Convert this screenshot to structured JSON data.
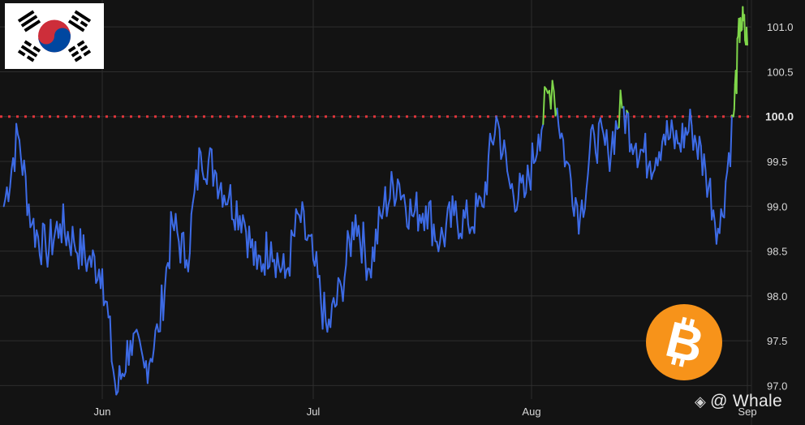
{
  "chart_data": {
    "type": "line",
    "title": "",
    "xlabel": "",
    "ylabel": "",
    "x_ticks": [
      "Jun",
      "Jul",
      "Aug",
      "Sep"
    ],
    "y_ticks": [
      "97.0",
      "97.5",
      "98.0",
      "98.5",
      "99.0",
      "99.5",
      "100.0",
      "100.5",
      "101.0"
    ],
    "ylim": [
      96.85,
      101.3
    ],
    "grid": true,
    "reference_line": {
      "value": 100.0,
      "label": "100.0",
      "color": "#e0353b",
      "style": "dotted"
    },
    "colors": {
      "below": "#3d6be6",
      "above": "#7fd64a",
      "background": "#131313",
      "grid": "#2e2e2e"
    },
    "series": [
      {
        "x": [
          "May 18",
          "May 20",
          "May 22",
          "May 24",
          "May 26",
          "May 28",
          "May 30",
          "Jun 01",
          "Jun 03",
          "Jun 05",
          "Jun 07",
          "Jun 09",
          "Jun 11",
          "Jun 13",
          "Jun 15",
          "Jun 17",
          "Jun 19",
          "Jun 21",
          "Jun 23",
          "Jun 25",
          "Jun 27",
          "Jun 29",
          "Jul 01",
          "Jul 03",
          "Jul 05",
          "Jul 07",
          "Jul 09",
          "Jul 11",
          "Jul 13",
          "Jul 15",
          "Jul 17",
          "Jul 19",
          "Jul 21",
          "Jul 23",
          "Jul 25",
          "Jul 27",
          "Jul 29",
          "Jul 31",
          "Aug 02",
          "Aug 04",
          "Aug 06",
          "Aug 08",
          "Aug 10",
          "Aug 12",
          "Aug 14",
          "Aug 16",
          "Aug 18",
          "Aug 20",
          "Aug 22",
          "Aug 24",
          "Aug 26",
          "Aug 28",
          "Aug 30",
          "Aug 31",
          "Sep 01"
        ],
        "values": [
          99.0,
          99.8,
          98.8,
          98.5,
          98.8,
          98.6,
          98.4,
          98.3,
          96.9,
          97.5,
          97.2,
          97.6,
          98.8,
          98.4,
          99.6,
          99.4,
          99.1,
          98.9,
          98.3,
          98.6,
          98.2,
          98.9,
          98.4,
          97.6,
          98.1,
          98.9,
          98.3,
          99.0,
          99.3,
          98.9,
          99.0,
          98.6,
          98.9,
          98.8,
          99.0,
          100.0,
          99.2,
          99.1,
          99.8,
          100.4,
          99.5,
          98.9,
          99.8,
          99.6,
          100.1,
          99.7,
          99.5,
          99.8,
          99.7,
          99.9,
          99.4,
          98.7,
          100.0,
          101.1,
          100.8
        ]
      }
    ]
  },
  "watermark": {
    "text": "@ Whale",
    "icon": "binance-diamond-icon"
  },
  "logos": {
    "flag": "south-korea-flag",
    "coin": "bitcoin-logo"
  }
}
